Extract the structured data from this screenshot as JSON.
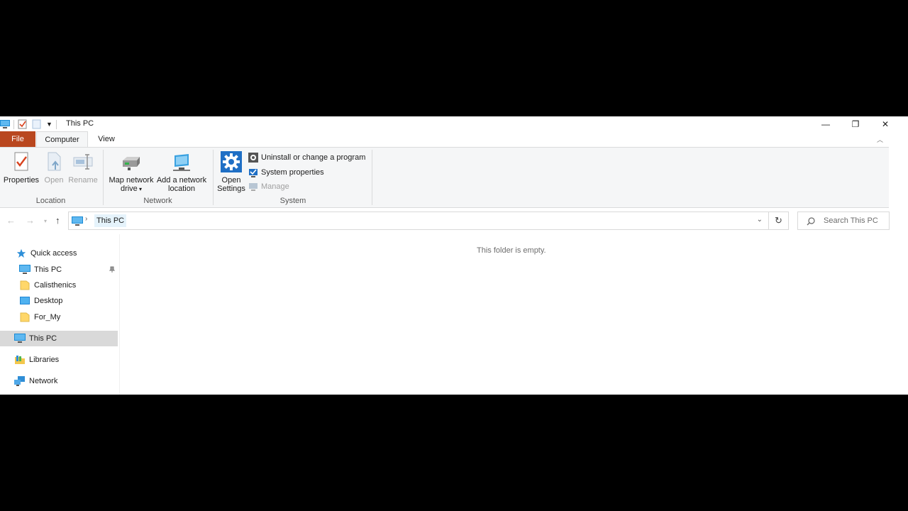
{
  "window": {
    "title": "This PC",
    "controls": {
      "minimize": "—",
      "restore": "❐",
      "close": "✕"
    }
  },
  "ribbon": {
    "tabs": {
      "file": "File",
      "computer": "Computer",
      "view": "View"
    },
    "location": {
      "label": "Location",
      "properties": "Properties",
      "open": "Open",
      "rename": "Rename"
    },
    "network": {
      "label": "Network",
      "map_drive_line1": "Map network",
      "map_drive_line2": "drive",
      "add_location_line1": "Add a network",
      "add_location_line2": "location"
    },
    "system": {
      "label": "System",
      "open_settings_line1": "Open",
      "open_settings_line2": "Settings",
      "uninstall": "Uninstall or change a program",
      "system_properties": "System properties",
      "manage": "Manage"
    }
  },
  "address": {
    "breadcrumb": "This PC",
    "search_placeholder": "Search This PC"
  },
  "nav_pane": {
    "quick_access": "Quick access",
    "quick_items": [
      "This PC",
      "Calisthenics",
      "Desktop",
      "For_My"
    ],
    "this_pc": "This PC",
    "libraries": "Libraries",
    "network": "Network"
  },
  "content": {
    "empty_message": "This folder is empty."
  },
  "colors": {
    "file_tab": "#b9471f",
    "selected": "#d9d9d9",
    "accent_blue": "#1a73c8"
  }
}
